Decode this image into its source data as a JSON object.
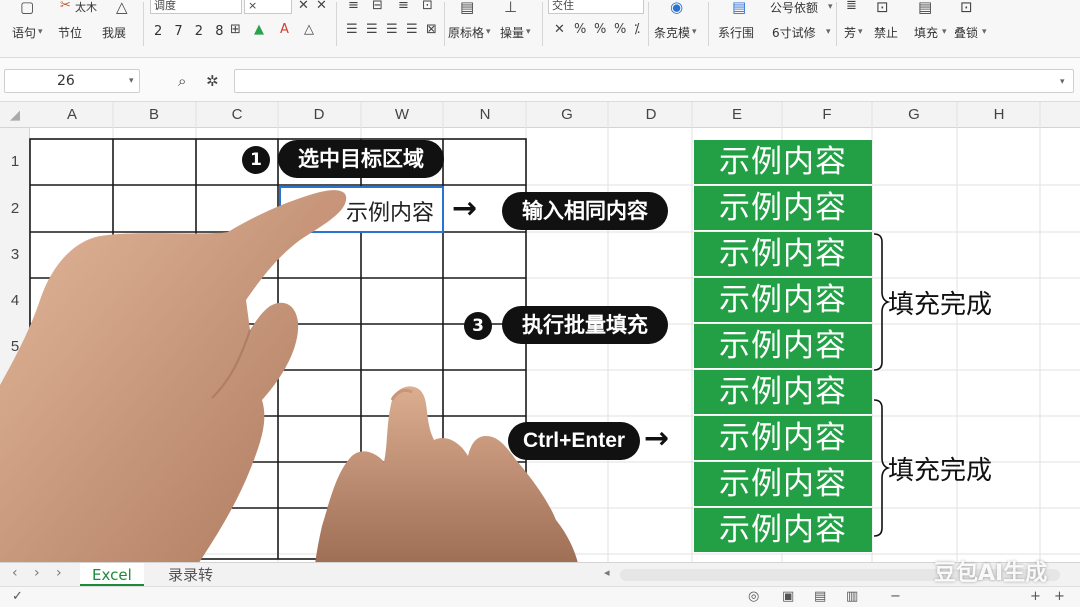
{
  "ribbon": {
    "group1": {
      "label_a": "语句",
      "label_b": "节位",
      "label_c": "我展",
      "sub": "太木"
    },
    "font": {
      "name": "调度",
      "size": "×",
      "nums": "2 7 2 8"
    },
    "group3": {
      "label_a": "原标格",
      "label_b": "操量"
    },
    "align": {
      "box": "交住"
    },
    "group5": {
      "label": "条克模"
    },
    "group6": {
      "label_a": "系行围",
      "label_b": "6寸试修",
      "box": "公号依额"
    },
    "group7": {
      "label_a": "芳",
      "label_b": "禁止",
      "label_c": "填充",
      "label_d": "叠锁"
    }
  },
  "formula_bar": {
    "cell_ref": "26",
    "formula": ""
  },
  "columns": [
    "A",
    "B",
    "C",
    "D",
    "W",
    "N",
    "G",
    "D",
    "E",
    "F",
    "G",
    "H"
  ],
  "rows": [
    "1",
    "2",
    "3",
    "4",
    "5"
  ],
  "selected_cell": {
    "text": "示例内容"
  },
  "steps": {
    "step1": {
      "number": "1",
      "label": "选中目标区域"
    },
    "step2": {
      "label": "输入相同内容"
    },
    "step3": {
      "number": "3",
      "label": "执行批量填充"
    },
    "shortcut": "Ctrl+Enter"
  },
  "filled_cells": [
    "示例内容",
    "示例内容",
    "示例内容",
    "示例内容",
    "示例内容",
    "示例内容",
    "示例内容",
    "示例内容",
    "示例内容"
  ],
  "completion_labels": [
    "填充完成",
    "填充完成"
  ],
  "sheet_tabs": {
    "active": "Excel",
    "other": "录录转"
  },
  "watermark": "豆包AI生成",
  "colors": {
    "fill_green": "#23a046",
    "selection_blue": "#2a73d4",
    "tab_green": "#1d8a3a"
  }
}
